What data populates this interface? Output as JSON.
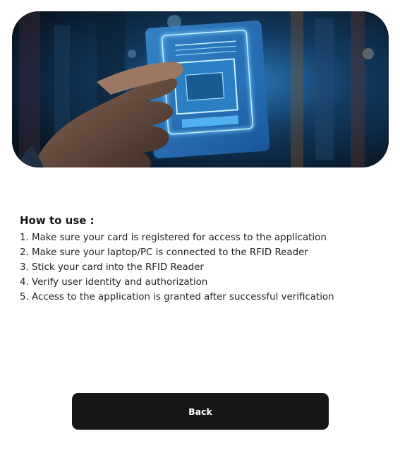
{
  "hero": {
    "image_subject": "hand-holding-glowing-rfid-card"
  },
  "instructions": {
    "heading": "How to use :",
    "steps": [
      "1. Make sure your card is registered for access to the application",
      "2. Make sure your laptop/PC is connected to the RFID Reader",
      "3. Stick your card into the RFID Reader",
      "4. Verify user identity and authorization",
      "5. Access to the application is granted after successful verification"
    ]
  },
  "actions": {
    "back_label": "Back"
  },
  "colors": {
    "button_bg": "#171717",
    "button_text": "#ffffff",
    "card_glow": "#4fc3ff"
  }
}
